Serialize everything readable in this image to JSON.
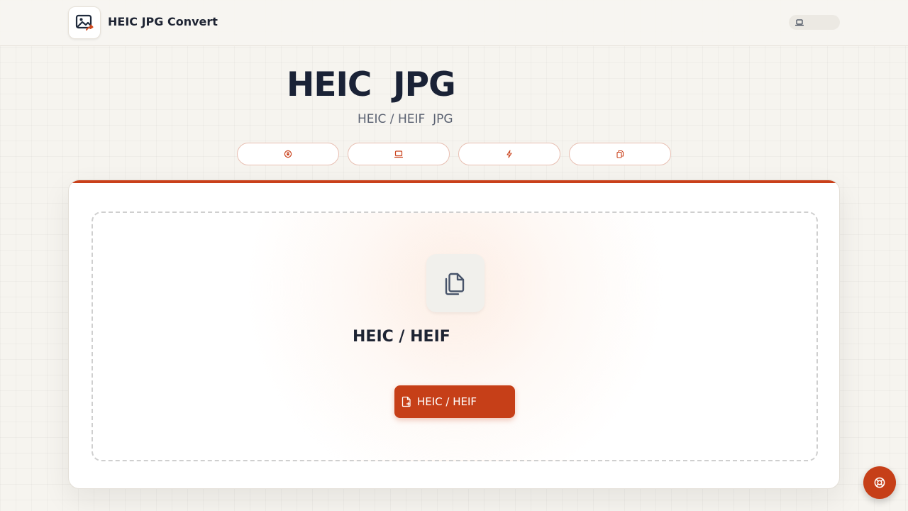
{
  "header": {
    "app_title": "HEIC JPG Convert",
    "logo_icon": "image-convert-icon",
    "language_toggle_icon": "laptop-icon"
  },
  "hero": {
    "title": "HEIC  JPG",
    "subtitle": "HEIC / HEIF  JPG"
  },
  "feature_pills": [
    {
      "icon": "shield-icon"
    },
    {
      "icon": "laptop-icon"
    },
    {
      "icon": "lightning-icon"
    },
    {
      "icon": "copy-icon"
    }
  ],
  "dropzone": {
    "icon": "copy-files-icon",
    "heading": "HEIC / HEIF",
    "button_label": "HEIC / HEIF",
    "button_icon": "file-add-icon"
  },
  "help_button": {
    "icon": "lifebuoy-icon"
  },
  "colors": {
    "accent": "#c63f18",
    "background": "#f6f4ef",
    "text_dark": "#1a2236",
    "pill_border": "#e8bfb2"
  }
}
